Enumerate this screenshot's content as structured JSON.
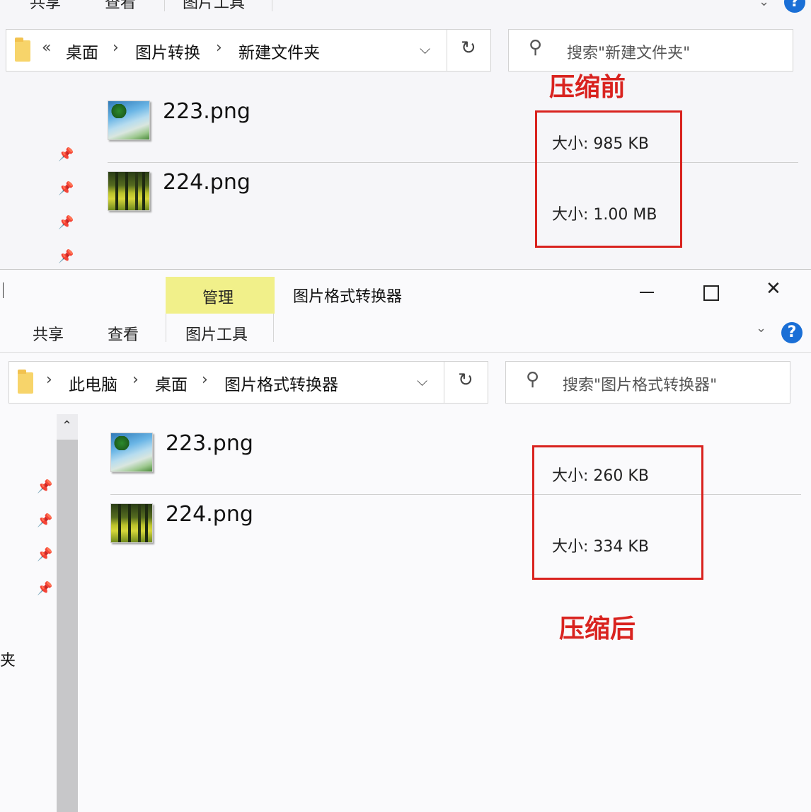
{
  "top": {
    "ribbon": {
      "share": "共享",
      "view": "查看",
      "tools": "图片工具"
    },
    "breadcrumb": [
      "桌面",
      "图片转换",
      "新建文件夹"
    ],
    "search_placeholder": "搜索\"新建文件夹\"",
    "files": [
      {
        "name": "223.png",
        "size": "大小: 985 KB"
      },
      {
        "name": "224.png",
        "size": "大小: 1.00 MB"
      }
    ],
    "annotation": "压缩前"
  },
  "bottom": {
    "window_title": "图片格式转换器",
    "ribbon": {
      "manage": "管理",
      "share": "共享",
      "view": "查看",
      "tools": "图片工具"
    },
    "breadcrumb": [
      "此电脑",
      "桌面",
      "图片格式转换器"
    ],
    "search_placeholder": "搜索\"图片格式转换器\"",
    "files": [
      {
        "name": "223.png",
        "size": "大小: 260 KB"
      },
      {
        "name": "224.png",
        "size": "大小: 334 KB"
      }
    ],
    "annotation": "压缩后",
    "sidebar_fragment": "夹"
  },
  "icons": {
    "folder": "folder-icon",
    "dropdown": "chevron-down-icon",
    "refresh": "refresh-icon",
    "search": "search-icon",
    "pin": "pin-icon",
    "help": "help-icon",
    "minimize": "minimize-icon",
    "maximize": "maximize-icon",
    "close": "close-icon",
    "help_glyph": "?"
  },
  "colors": {
    "annotation_red": "#d9231f",
    "manage_tab": "#f1f08a",
    "help_blue": "#1a6fd6"
  }
}
